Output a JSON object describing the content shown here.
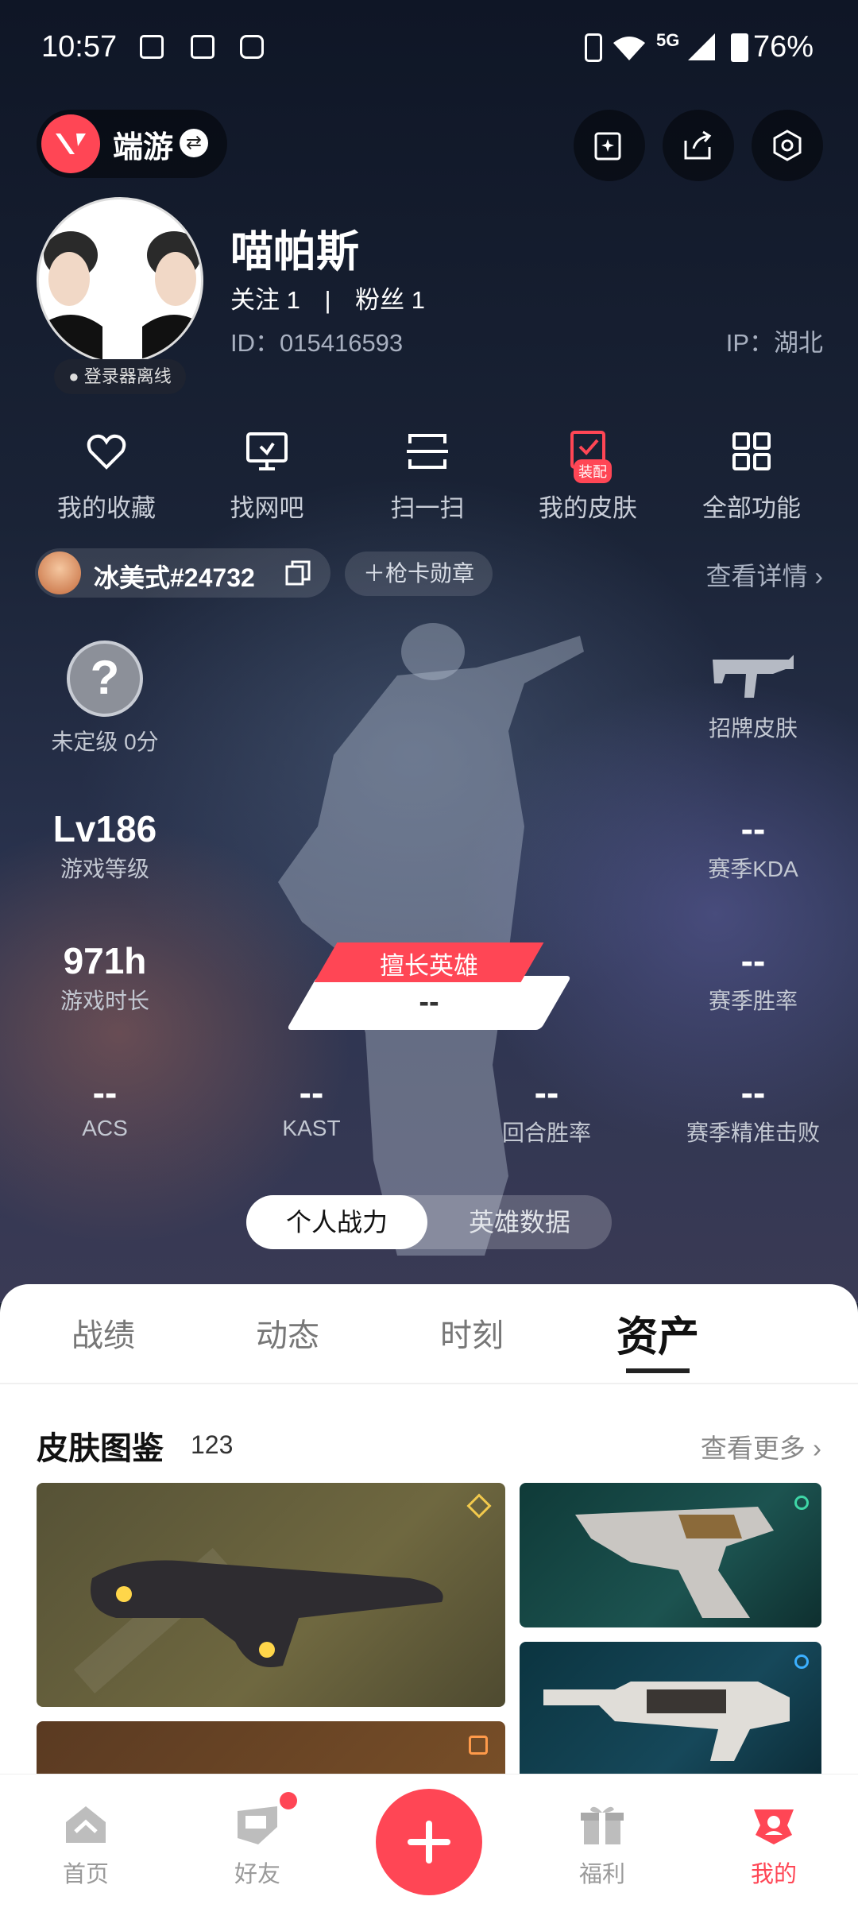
{
  "status_bar": {
    "time": "10:57",
    "network": "5G",
    "battery": "76%"
  },
  "header": {
    "game_name": "端游",
    "accent": "#ff4655"
  },
  "profile": {
    "name": "喵帕斯",
    "follow": "关注 1",
    "separator": "|",
    "fans": "粉丝 1",
    "id": "ID：015416593",
    "ip": "IP：湖北",
    "login_status": "登录器离线"
  },
  "quick_menu": [
    {
      "label": "我的收藏",
      "icon": "heart-icon"
    },
    {
      "label": "找网吧",
      "icon": "monitor-icon"
    },
    {
      "label": "扫一扫",
      "icon": "scan-icon"
    },
    {
      "label": "我的皮肤",
      "icon": "skin-icon",
      "badge": "装配"
    },
    {
      "label": "全部功能",
      "icon": "grid-icon"
    }
  ],
  "riot": {
    "name": "冰美式#24732",
    "medal_label": "枪卡勋章",
    "detail_link": "查看详情"
  },
  "stats": {
    "rank": {
      "icon": "?",
      "label": "未定级 0分"
    },
    "skin": {
      "label": "招牌皮肤"
    },
    "level": {
      "value": "Lv186",
      "label": "游戏等级"
    },
    "kda": {
      "value": "--",
      "label": "赛季KDA"
    },
    "hours": {
      "value": "971h",
      "label": "游戏时长"
    },
    "winrate": {
      "value": "--",
      "label": "赛季胜率"
    },
    "best_hero": {
      "tag": "擅长英雄",
      "value": "--"
    },
    "acs": {
      "value": "--",
      "label": "ACS"
    },
    "kast": {
      "value": "--",
      "label": "KAST"
    },
    "round_winrate": {
      "value": "--",
      "label": "回合胜率"
    },
    "precise_kills": {
      "value": "--",
      "label": "赛季精准击败"
    }
  },
  "toggle": {
    "active": "个人战力",
    "inactive": "英雄数据"
  },
  "tabs": [
    "战绩",
    "动态",
    "时刻",
    "资产"
  ],
  "skins": {
    "title": "皮肤图鉴",
    "count": "123",
    "more": "查看更多"
  },
  "nav": [
    {
      "label": "首页",
      "icon": "home-icon"
    },
    {
      "label": "好友",
      "icon": "friends-icon"
    },
    {
      "label": "",
      "icon": "plus-icon"
    },
    {
      "label": "福利",
      "icon": "gift-icon"
    },
    {
      "label": "我的",
      "icon": "profile-icon",
      "active": true
    }
  ]
}
